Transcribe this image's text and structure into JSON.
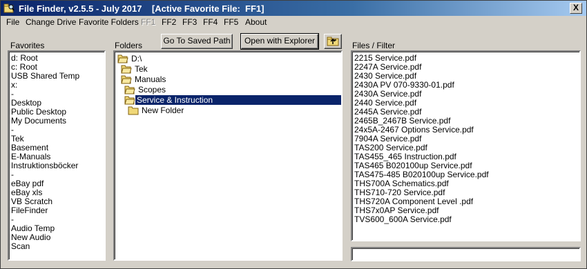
{
  "window": {
    "title": "File Finder, v2.5.5 - July 2017    [Active Favorite File:  FF1]",
    "close_label": "X"
  },
  "menu": {
    "items": [
      "File",
      "Change Drive",
      "Favorite Folders",
      "FF1",
      "FF2",
      "FF3",
      "FF4",
      "FF5",
      "About"
    ]
  },
  "favorites": {
    "label": "Favorites",
    "items": [
      "d: Root",
      "c: Root",
      "USB Shared Temp",
      "x:",
      "-",
      "Desktop",
      "Public Desktop",
      "My Documents",
      "-",
      "Tek",
      "Basement",
      "E-Manuals",
      "Instruktionsböcker",
      "-",
      "eBay pdf",
      "eBay xls",
      "VB Scratch",
      "FileFinder",
      "-",
      "Audio Temp",
      "New Audio",
      "Scan"
    ]
  },
  "folders": {
    "label": "Folders",
    "tree": [
      "D:\\",
      "Tek",
      "Manuals",
      "Scopes",
      "Service & Instruction",
      "New Folder"
    ],
    "selected": "Service & Instruction"
  },
  "toolbar": {
    "go_saved_label": "Go To Saved Path",
    "open_explorer_label": "Open with Explorer",
    "up_icon": "folder-up-icon"
  },
  "files": {
    "label": "Files / Filter",
    "items": [
      "2215 Service.pdf",
      "2247A Service.pdf",
      "2430 Service.pdf",
      "2430A PV 070-9330-01.pdf",
      "2430A Service.pdf",
      "2440 Service.pdf",
      "2445A Service.pdf",
      "2465B_2467B Service.pdf",
      "24x5A-2467 Options Service.pdf",
      "7904A Service.pdf",
      "TAS200 Service.pdf",
      "TAS455_465 Instruction.pdf",
      "TAS465 B020100up Service.pdf",
      "TAS475-485 B020100up Service.pdf",
      "THS700A Schematics.pdf",
      "THS710-720 Service.pdf",
      "THS720A Component Level .pdf",
      "THS7x0AP Service.pdf",
      "TVS600_600A Service.pdf"
    ],
    "filter_value": ""
  },
  "colors": {
    "titlebar": "#0a246a",
    "selection": "#0a246a",
    "face": "#d4d0c8",
    "folder": "#f0d878"
  }
}
